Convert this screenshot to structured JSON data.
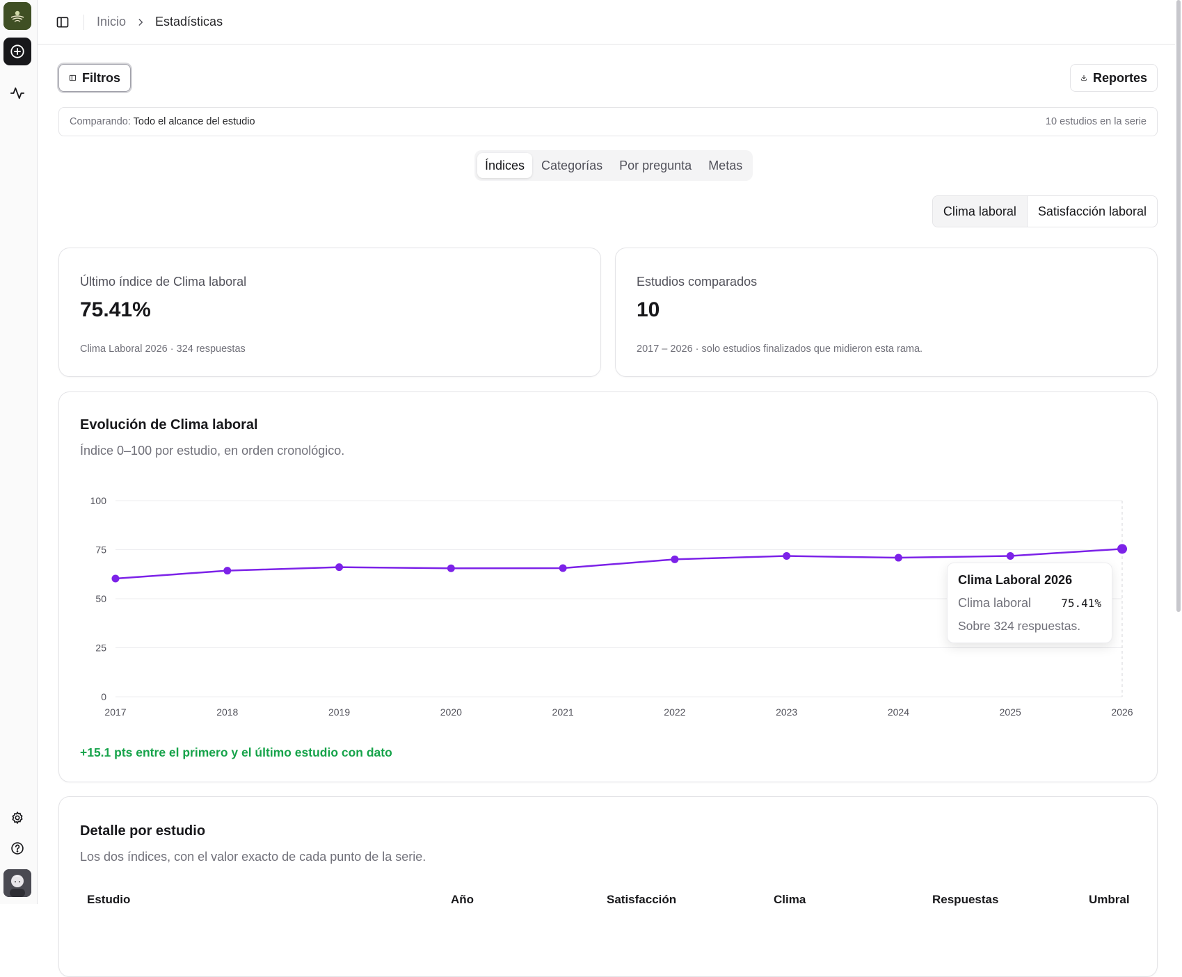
{
  "breadcrumb": {
    "home": "Inicio",
    "current": "Estadísticas"
  },
  "sidebar": {
    "icons": [
      "brand-logo",
      "plus-circle-icon",
      "activity-icon",
      "gear-icon",
      "help-icon",
      "user-avatar"
    ]
  },
  "toolbar": {
    "filters_label": "Filtros",
    "reports_label": "Reportes"
  },
  "compare": {
    "label": "Comparando:",
    "value": "Todo el alcance del estudio",
    "count": "10 estudios en la serie"
  },
  "tabs": [
    {
      "label": "Índices",
      "active": true
    },
    {
      "label": "Categorías",
      "active": false
    },
    {
      "label": "Por pregunta",
      "active": false
    },
    {
      "label": "Metas",
      "active": false
    }
  ],
  "index_toggle": [
    {
      "label": "Clima laboral",
      "active": true
    },
    {
      "label": "Satisfacción laboral",
      "active": false
    }
  ],
  "stats": {
    "latest": {
      "label": "Último índice de Clima laboral",
      "value": "75.41%",
      "sub": "Clima Laboral 2026 · 324 respuestas"
    },
    "compared": {
      "label": "Estudios comparados",
      "value": "10",
      "sub": "2017 – 2026 · solo estudios finalizados que midieron esta rama."
    }
  },
  "chart": {
    "title": "Evolución de Clima laboral",
    "subtitle": "Índice 0–100 por estudio, en orden cronológico.",
    "footer": "+15.1 pts entre el primero y el último estudio con dato",
    "tooltip": {
      "title": "Clima Laboral 2026",
      "series_label": "Clima laboral",
      "value": "75.41%",
      "note": "Sobre 324 respuestas."
    }
  },
  "chart_data": {
    "type": "line",
    "x": [
      "2017",
      "2018",
      "2019",
      "2020",
      "2021",
      "2022",
      "2023",
      "2024",
      "2025",
      "2026"
    ],
    "series": [
      {
        "name": "Clima laboral",
        "values": [
          60.3,
          64.3,
          66.1,
          65.5,
          65.6,
          70.1,
          71.8,
          70.9,
          71.8,
          75.41
        ]
      }
    ],
    "ylim": [
      0,
      100
    ],
    "yticks": [
      0,
      25,
      50,
      75,
      100
    ],
    "grid": true,
    "color": "#7c22e8",
    "highlighted_index": 9
  },
  "detail": {
    "title": "Detalle por estudio",
    "subtitle": "Los dos índices, con el valor exacto de cada punto de la serie.",
    "columns": [
      "Estudio",
      "Año",
      "Satisfacción",
      "Clima",
      "Respuestas",
      "Umbral"
    ]
  }
}
